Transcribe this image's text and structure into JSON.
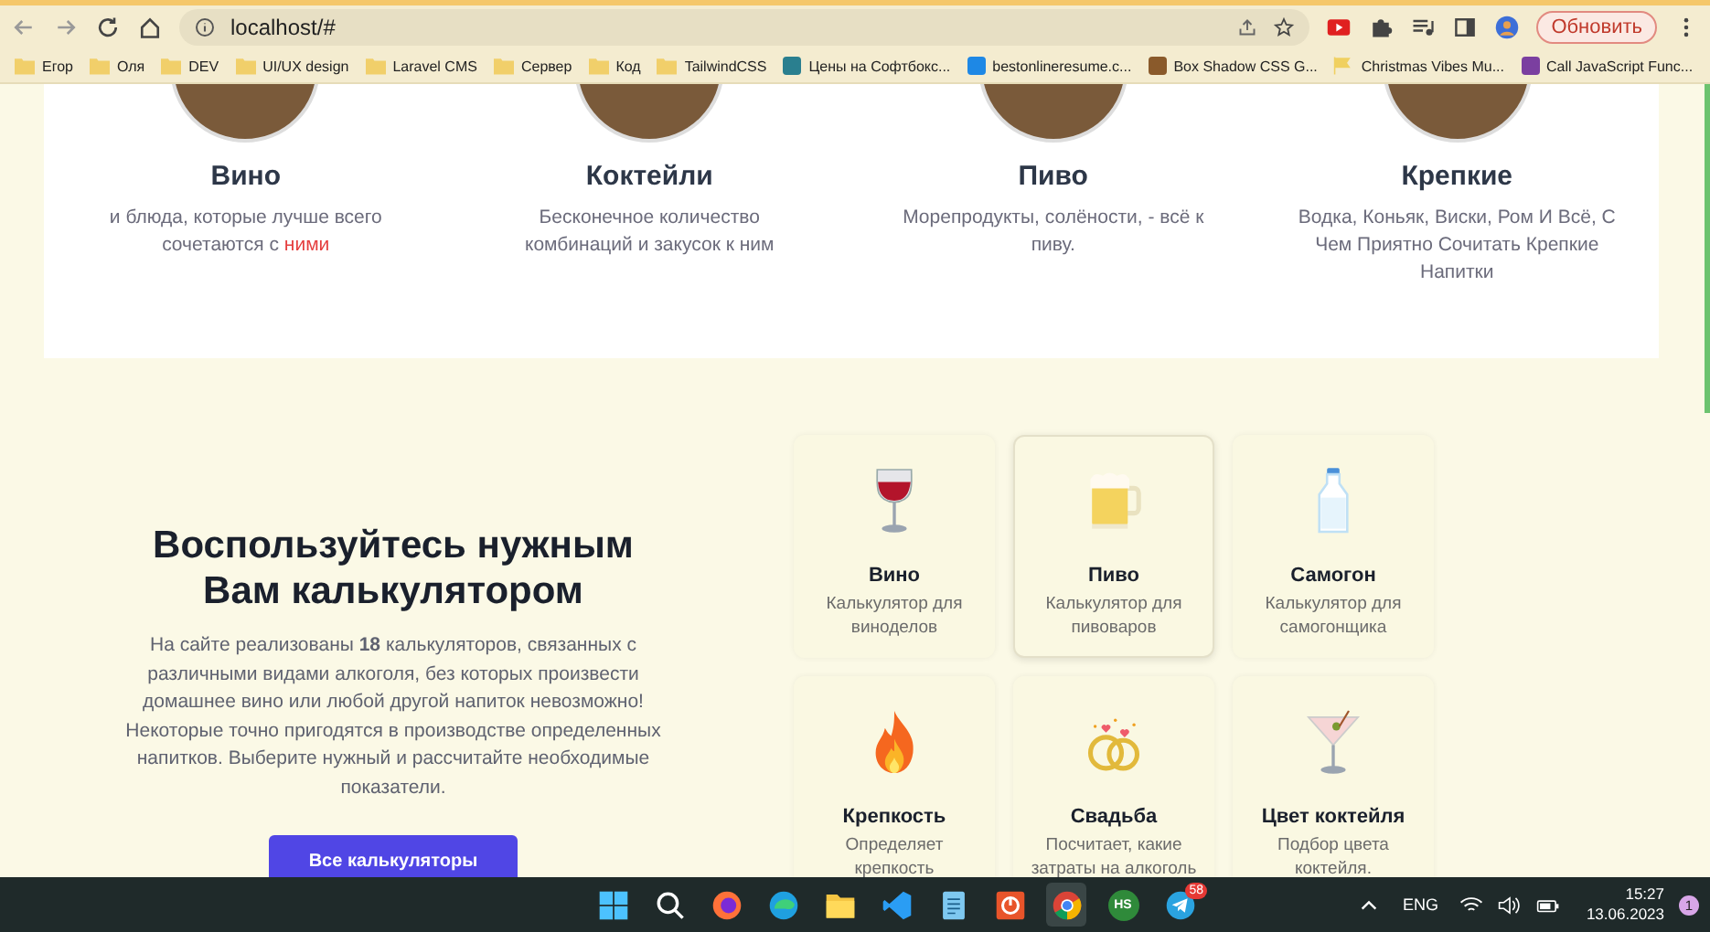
{
  "browser": {
    "url": "localhost/#",
    "update_button": "Обновить"
  },
  "bookmarks": [
    {
      "label": "Егор",
      "kind": "folder"
    },
    {
      "label": "Оля",
      "kind": "folder"
    },
    {
      "label": "DEV",
      "kind": "folder"
    },
    {
      "label": "UI/UX design",
      "kind": "folder"
    },
    {
      "label": "Laravel CMS",
      "kind": "folder"
    },
    {
      "label": "Сервер",
      "kind": "folder"
    },
    {
      "label": "Код",
      "kind": "folder"
    },
    {
      "label": "TailwindCSS",
      "kind": "folder"
    },
    {
      "label": "Цены на Софтбокс...",
      "kind": "site",
      "color": "#2a7f8f"
    },
    {
      "label": "bestonlineresume.c...",
      "kind": "site",
      "color": "#1e88e5"
    },
    {
      "label": "Box Shadow CSS G...",
      "kind": "site",
      "color": "#8a5a2b"
    },
    {
      "label": "Christmas Vibes Mu...",
      "kind": "flag",
      "color": "#f0d060"
    },
    {
      "label": "Call JavaScript Func...",
      "kind": "site",
      "color": "#7b3fa0"
    }
  ],
  "pairings": [
    {
      "title": "Вино",
      "description": "и блюда, которые лучше всего сочетаются с",
      "link": "ними"
    },
    {
      "title": "Коктейли",
      "description": "Бесконечное количество комбинаций и закусок к ним"
    },
    {
      "title": "Пиво",
      "description": "Морепродукты, солёности, - всё к пиву."
    },
    {
      "title": "Крепкие",
      "description": "Водка, Коньяк, Виски, Ром И Всё, С Чем Приятно Сочитать Крепкие Напитки"
    }
  ],
  "calculators_section": {
    "heading": "Воспользуйтесь нужным Вам калькулятором",
    "text": "На сайте реализованы **18** калькуляторов, связанных с различными видами алкоголя, без которых произвести домашнее вино или любой другой напиток невозможно! Некоторые точно пригодятся в производстве определенных напитков. Выберите нужный и рассчитайте необходимые показатели.",
    "button": "Все калькуляторы"
  },
  "calculators": [
    {
      "title": "Вино",
      "description": "Калькулятор для виноделов",
      "kind": "wine",
      "selected": false
    },
    {
      "title": "Пиво",
      "description": "Калькулятор для пивоваров",
      "kind": "beer",
      "selected": true
    },
    {
      "title": "Самогон",
      "description": "Калькулятор для самогонщика",
      "kind": "bottle",
      "selected": false
    },
    {
      "title": "Крепкость",
      "description": "Определяет крепкость",
      "kind": "fire",
      "selected": false
    },
    {
      "title": "Свадьба",
      "description": "Посчитает, какие затраты на алкоголь",
      "kind": "rings",
      "selected": false
    },
    {
      "title": "Цвет коктейля",
      "description": "Подбор цвета коктейля.",
      "kind": "cocktail",
      "selected": false
    }
  ],
  "taskbar": {
    "apps": [
      {
        "kind": "start"
      },
      {
        "kind": "search"
      },
      {
        "kind": "firefox"
      },
      {
        "kind": "edge"
      },
      {
        "kind": "folder"
      },
      {
        "kind": "vscode"
      },
      {
        "kind": "notepad"
      },
      {
        "kind": "orange"
      },
      {
        "kind": "chrome",
        "selected": true
      },
      {
        "kind": "hs",
        "label": "HS"
      },
      {
        "kind": "telegram",
        "badge": "58"
      }
    ],
    "language": "ENG",
    "time": "15:27",
    "date": "13.06.2023",
    "notifications": "1"
  }
}
